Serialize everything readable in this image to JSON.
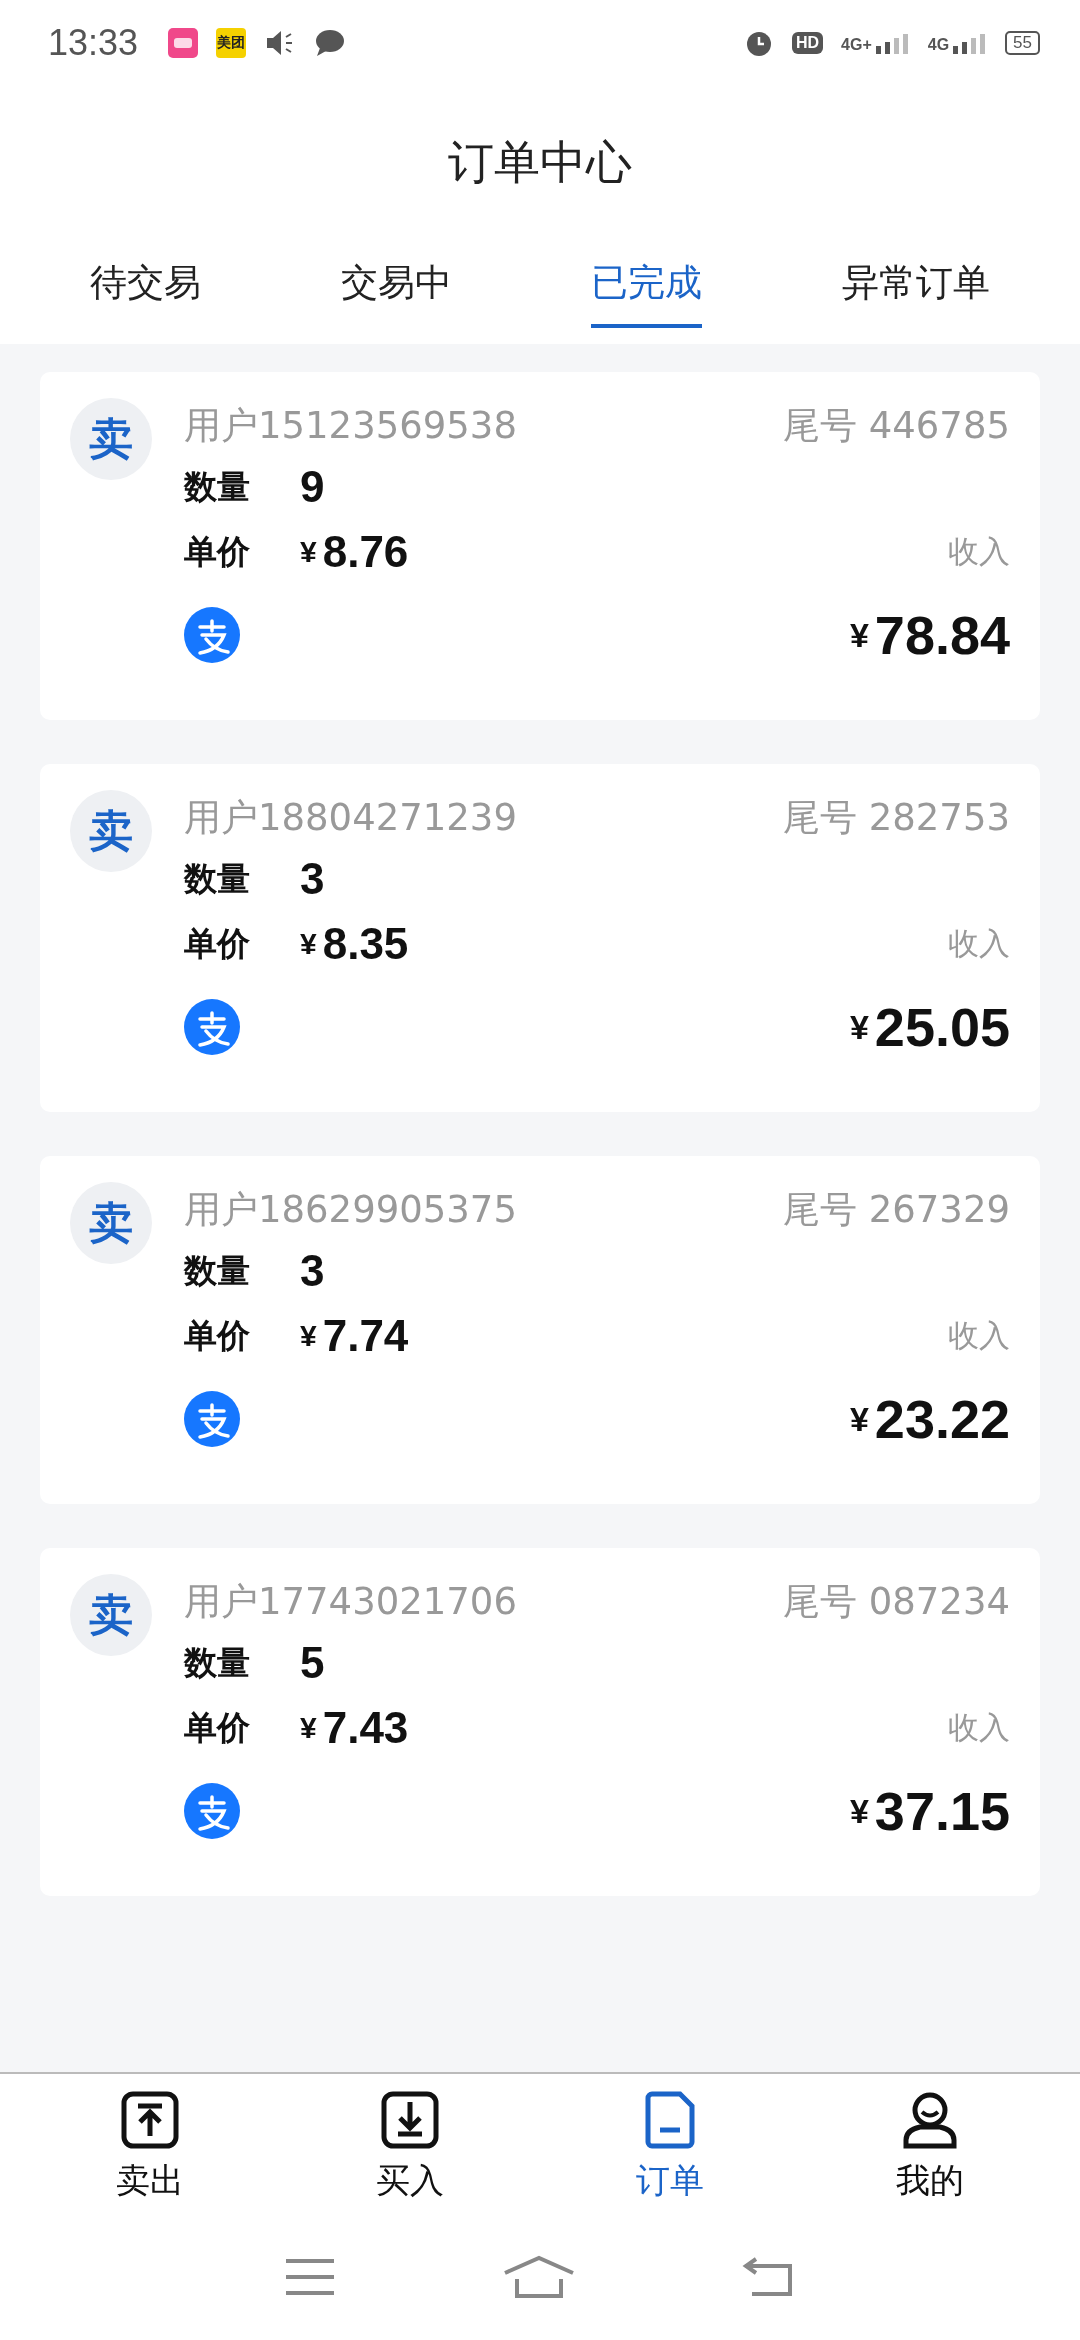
{
  "status_bar": {
    "time": "13:33",
    "app_label": "美团",
    "hd": "HD",
    "sim_labels": [
      "4G+",
      "4G"
    ],
    "battery": "55"
  },
  "title": "订单中心",
  "tabs": [
    {
      "label": "待交易",
      "selected": false
    },
    {
      "label": "交易中",
      "selected": false
    },
    {
      "label": "已完成",
      "selected": true
    },
    {
      "label": "异常订单",
      "selected": false
    }
  ],
  "orders": [
    {
      "badge": "卖",
      "user": "用户15123569538",
      "tail": "尾号 446785",
      "qty_label": "数量",
      "qty": "9",
      "price_label": "单价",
      "price_currency": "¥",
      "price": "8.76",
      "income_label": "收入",
      "amount_currency": "¥",
      "amount": "78.84"
    },
    {
      "badge": "卖",
      "user": "用户18804271239",
      "tail": "尾号 282753",
      "qty_label": "数量",
      "qty": "3",
      "price_label": "单价",
      "price_currency": "¥",
      "price": "8.35",
      "income_label": "收入",
      "amount_currency": "¥",
      "amount": "25.05"
    },
    {
      "badge": "卖",
      "user": "用户18629905375",
      "tail": "尾号 267329",
      "qty_label": "数量",
      "qty": "3",
      "price_label": "单价",
      "price_currency": "¥",
      "price": "7.74",
      "income_label": "收入",
      "amount_currency": "¥",
      "amount": "23.22"
    },
    {
      "badge": "卖",
      "user": "用户17743021706",
      "tail": "尾号 087234",
      "qty_label": "数量",
      "qty": "5",
      "price_label": "单价",
      "price_currency": "¥",
      "price": "7.43",
      "income_label": "收入",
      "amount_currency": "¥",
      "amount": "37.15"
    }
  ],
  "nav": [
    {
      "kind": "upload",
      "label": "卖出",
      "selected": false
    },
    {
      "kind": "download",
      "label": "买入",
      "selected": false
    },
    {
      "kind": "document",
      "label": "订单",
      "selected": true
    },
    {
      "kind": "person",
      "label": "我的",
      "selected": false
    }
  ]
}
